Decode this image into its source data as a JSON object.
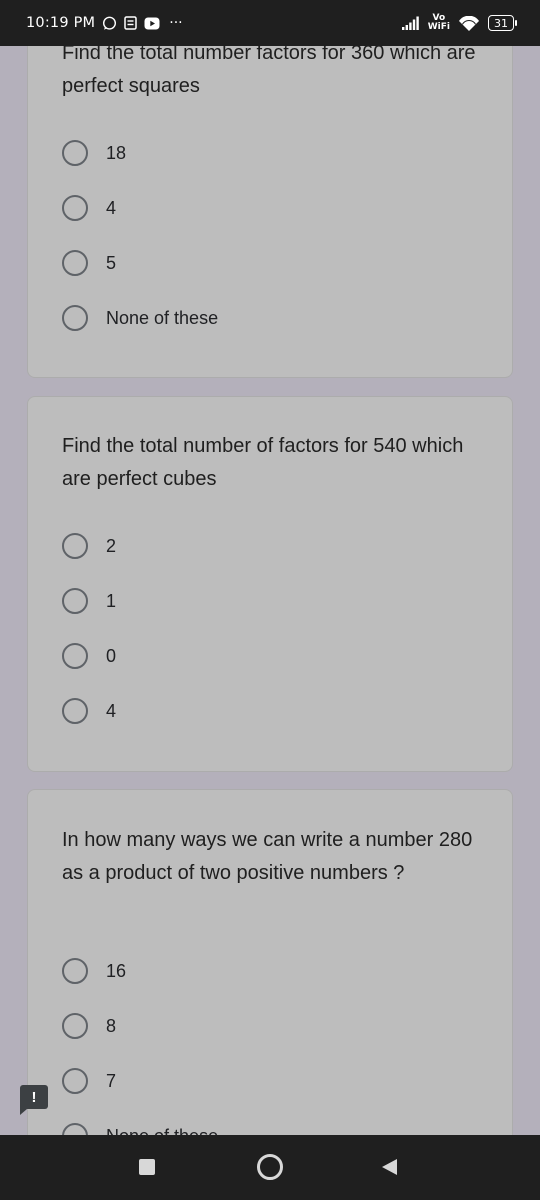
{
  "status_bar": {
    "time": "10:19 PM",
    "notification_icons": [
      "whatsapp-icon",
      "message-icon",
      "youtube-icon"
    ],
    "more": "···",
    "vowifi_top": "Vo",
    "vowifi_bottom": "WiFi",
    "battery": "31"
  },
  "questions": [
    {
      "text": "Find the total number  factors for 360 which are perfect squares",
      "options": [
        "18",
        "4",
        "5",
        "None of these"
      ]
    },
    {
      "text": "Find the total number of factors for 540 which are perfect cubes",
      "options": [
        "2",
        "1",
        "0",
        "4"
      ]
    },
    {
      "text": "In how many ways we can write a number 280 as a product of two positive numbers ?",
      "options": [
        "16",
        "8",
        "7",
        "None of these"
      ]
    }
  ],
  "feedback": {
    "label": "!"
  },
  "colors": {
    "page_background": "#b4b0bb",
    "card_background": "#bdbdbd",
    "system_bar": "#1f1f1f"
  }
}
